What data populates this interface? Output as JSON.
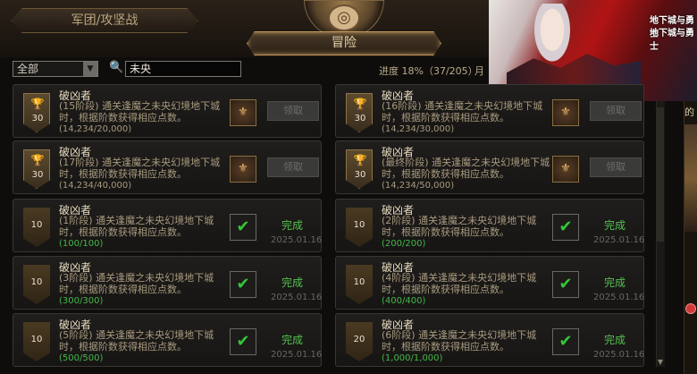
{
  "header": {
    "tab_guild": "军团/攻坚战",
    "tab_adventure": "冒险",
    "emblem_icon": "compass-emblem-icon"
  },
  "ad": {
    "logo_line1": "地下城与勇士",
    "logo_line2": "地下城与勇士"
  },
  "filter": {
    "category_value": "全部",
    "search_value": "未央",
    "progress_label": "进度",
    "progress_text": "18%（37/205）",
    "progress_extra": "月"
  },
  "right_strip": {
    "text": "的"
  },
  "cards": [
    {
      "title": "破凶者",
      "desc": "(15阶段) 通关逢魔之未央幻境地下城时，根据阶数获得相应点数。",
      "progress": "(14,234/20,000)",
      "points": "30",
      "completed": false,
      "action": "领取"
    },
    {
      "title": "破凶者",
      "desc": "(16阶段) 通关逢魔之未央幻境地下城时，根据阶数获得相应点数。",
      "progress": "(14,234/30,000)",
      "points": "30",
      "completed": false,
      "action": "领取"
    },
    {
      "title": "破凶者",
      "desc": "(17阶段) 通关逢魔之未央幻境地下城时，根据阶数获得相应点数。",
      "progress": "(14,234/40,000)",
      "points": "30",
      "completed": false,
      "action": "领取"
    },
    {
      "title": "破凶者",
      "desc": "(最终阶段) 通关逢魔之未央幻境地下城时，根据阶数获得相应点数。",
      "progress": "(14,234/50,000)",
      "points": "30",
      "completed": false,
      "action": "领取"
    },
    {
      "title": "破凶者",
      "desc": "(1阶段) 通关逢魔之未央幻境地下城时，根据阶数获得相应点数。",
      "progress": "(100/100)",
      "points": "10",
      "completed": true,
      "status": "完成",
      "date": "2025.01.16"
    },
    {
      "title": "破凶者",
      "desc": "(2阶段) 通关逢魔之未央幻境地下城时，根据阶数获得相应点数。",
      "progress": "(200/200)",
      "points": "10",
      "completed": true,
      "status": "完成",
      "date": "2025.01.16"
    },
    {
      "title": "破凶者",
      "desc": "(3阶段) 通关逢魔之未央幻境地下城时，根据阶数获得相应点数。",
      "progress": "(300/300)",
      "points": "10",
      "completed": true,
      "status": "完成",
      "date": "2025.01.16"
    },
    {
      "title": "破凶者",
      "desc": "(4阶段) 通关逢魔之未央幻境地下城时，根据阶数获得相应点数。",
      "progress": "(400/400)",
      "points": "10",
      "completed": true,
      "status": "完成",
      "date": "2025.01.16"
    },
    {
      "title": "破凶者",
      "desc": "(5阶段) 通关逢魔之未央幻境地下城时，根据阶数获得相应点数。",
      "progress": "(500/500)",
      "points": "10",
      "completed": true,
      "status": "完成",
      "date": "2025.01.16"
    },
    {
      "title": "破凶者",
      "desc": "(6阶段) 通关逢魔之未央幻境地下城时，根据阶数获得相应点数。",
      "progress": "(1,000/1,000)",
      "points": "20",
      "completed": true,
      "status": "完成",
      "date": "2025.01.16"
    }
  ],
  "icons": {
    "badge": "trophy-badge-icon",
    "reward": "reward-emblem-icon",
    "done": "checkmark-icon"
  }
}
